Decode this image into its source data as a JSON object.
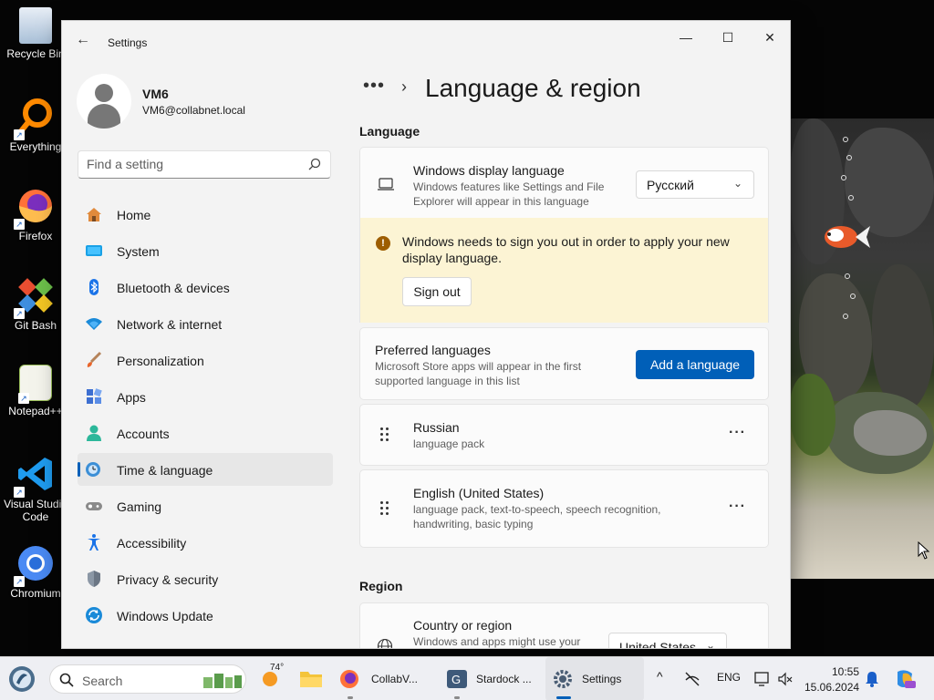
{
  "desktop": {
    "icons": [
      {
        "label": "Recycle Bin"
      },
      {
        "label": "Everything"
      },
      {
        "label": "Firefox"
      },
      {
        "label": "Git Bash"
      },
      {
        "label": "Notepad++"
      },
      {
        "label": "Visual Studio Code"
      },
      {
        "label": "Chromium"
      }
    ]
  },
  "window": {
    "title": "Settings",
    "minimize": "—",
    "maximize": "☐",
    "close": "✕"
  },
  "profile": {
    "name": "VM6",
    "email": "VM6@collabnet.local"
  },
  "search": {
    "placeholder": "Find a setting"
  },
  "nav": {
    "items": [
      {
        "label": "Home",
        "icon": "home-icon"
      },
      {
        "label": "System",
        "icon": "system-icon"
      },
      {
        "label": "Bluetooth & devices",
        "icon": "bluetooth-icon"
      },
      {
        "label": "Network & internet",
        "icon": "network-icon"
      },
      {
        "label": "Personalization",
        "icon": "brush-icon"
      },
      {
        "label": "Apps",
        "icon": "apps-icon"
      },
      {
        "label": "Accounts",
        "icon": "accounts-icon"
      },
      {
        "label": "Time & language",
        "icon": "time-language-icon",
        "selected": true
      },
      {
        "label": "Gaming",
        "icon": "gaming-icon"
      },
      {
        "label": "Accessibility",
        "icon": "accessibility-icon"
      },
      {
        "label": "Privacy & security",
        "icon": "shield-icon"
      },
      {
        "label": "Windows Update",
        "icon": "update-icon"
      }
    ]
  },
  "breadcrumb": {
    "dots": "•••",
    "chevron": "›",
    "title": "Language & region"
  },
  "language": {
    "heading": "Language",
    "display": {
      "title": "Windows display language",
      "desc": "Windows features like Settings and File Explorer will appear in this language",
      "value": "Русский"
    },
    "warning": {
      "text": "Windows needs to sign you out in order to apply your new display language.",
      "button": "Sign out"
    },
    "preferred": {
      "title": "Preferred languages",
      "desc": "Microsoft Store apps will appear in the first supported language in this list",
      "button": "Add a language"
    },
    "list": [
      {
        "name": "Russian",
        "features": "language pack"
      },
      {
        "name": "English (United States)",
        "features": "language pack, text-to-speech, speech recognition, handwriting, basic typing"
      }
    ]
  },
  "region": {
    "heading": "Region",
    "country": {
      "title": "Country or region",
      "desc": "Windows and apps might use your",
      "value": "United States"
    }
  },
  "taskbar": {
    "search": "Search",
    "weather": "74°",
    "apps": [
      {
        "label": "CollabV..."
      },
      {
        "label": "Stardock ..."
      },
      {
        "label": "Settings"
      }
    ],
    "lang": "ENG",
    "time": "10:55",
    "date": "15.06.2024"
  },
  "colors": {
    "accent": "#005fb8",
    "warning_bg": "#fcf4d4",
    "window_bg": "#f3f3f3"
  }
}
